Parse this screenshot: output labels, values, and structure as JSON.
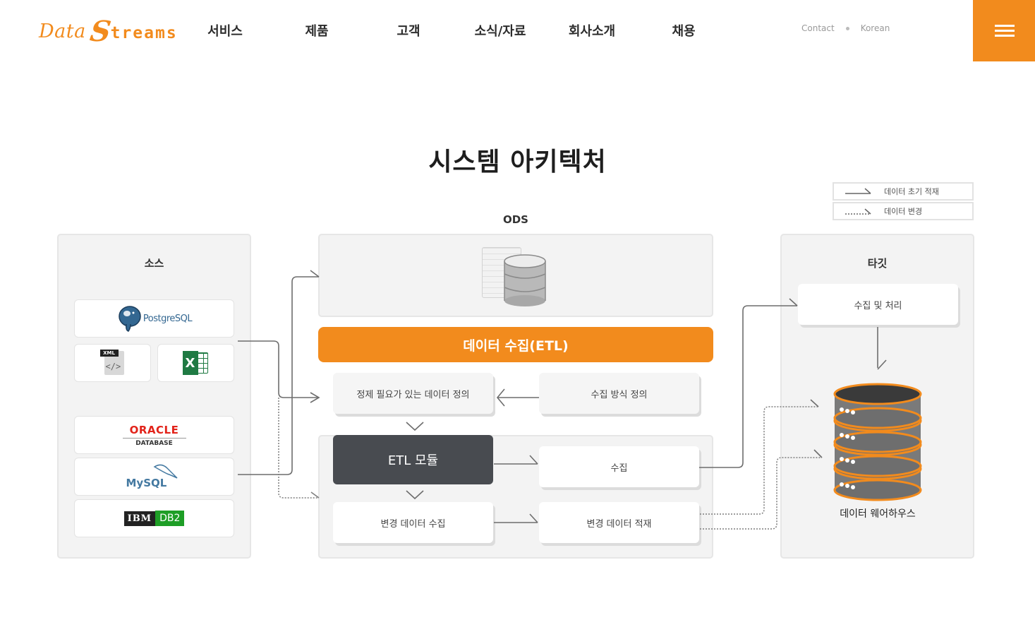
{
  "logo": {
    "part1": "Data",
    "part2": "S",
    "part3": "treams"
  },
  "nav": {
    "items": [
      "서비스",
      "제품",
      "고객",
      "소식/자료",
      "회사소개",
      "채용"
    ]
  },
  "util": {
    "contact": "Contact",
    "language": "Korean"
  },
  "page_title": "시스템 아키텍처",
  "legend": {
    "initial_load": "데이터 초기 적재",
    "change_data": "데이터 변경"
  },
  "source": {
    "title": "소스",
    "items": [
      "PostgreSQL",
      "XML",
      "X",
      "ORACLE",
      "DATABASE",
      "MySQL",
      "IBM",
      "DB2"
    ]
  },
  "ods": {
    "title": "ODS",
    "etl_bar": "데이터 수집(ETL)",
    "define_data": "정제 필요가 있는 데이터 정의",
    "define_method": "수집 방식 정의",
    "etl_module": "ETL 모듈",
    "collect": "수집",
    "cdc": "변경 데이터 수집",
    "cdc_load": "변경 데이터 적재"
  },
  "target": {
    "title": "타깃",
    "process": "수집 및 처리",
    "warehouse": "데이터 웨어하우스"
  },
  "colors": {
    "accent": "#f28b1d",
    "module": "#484b50",
    "panel": "#f3f3f3"
  }
}
